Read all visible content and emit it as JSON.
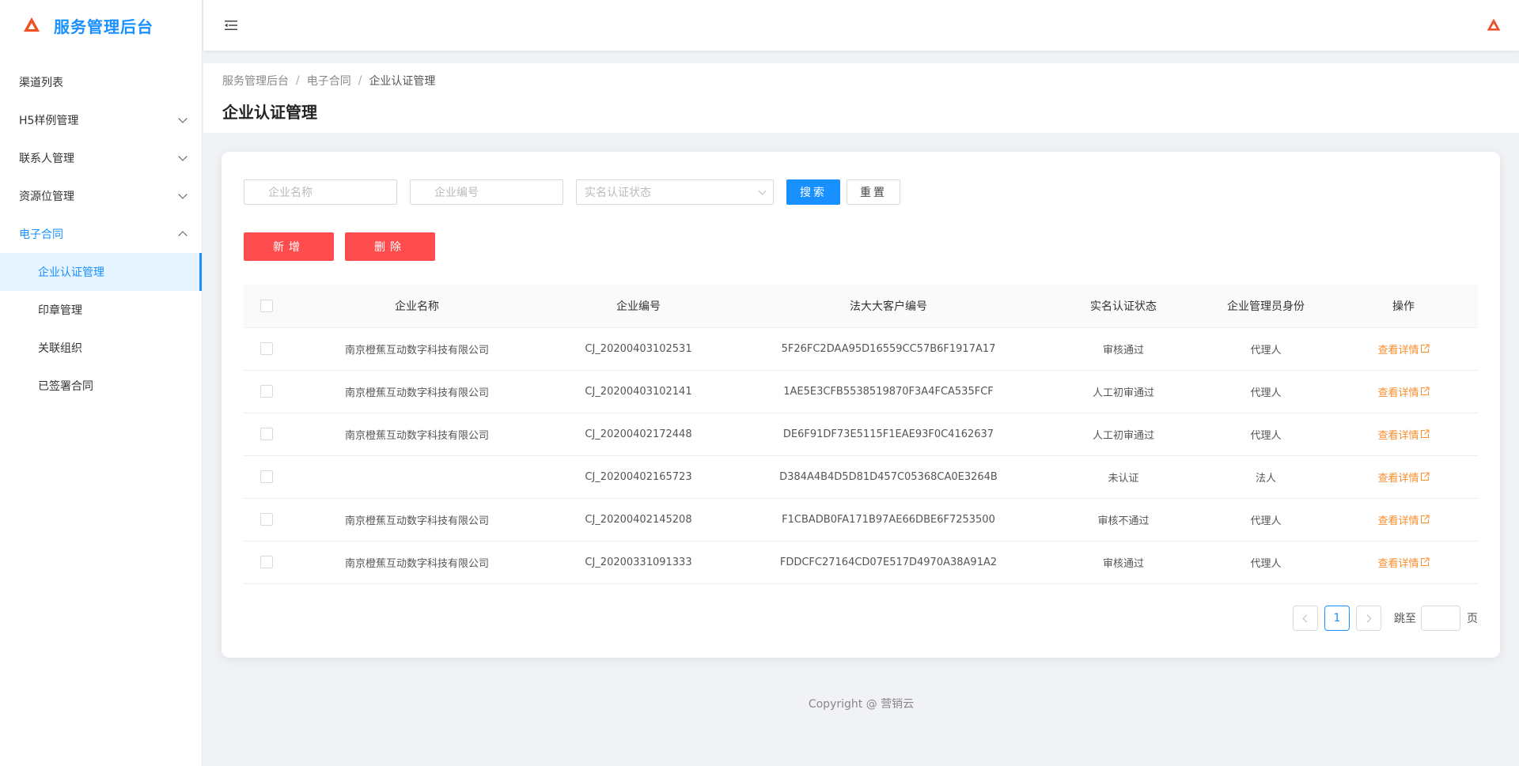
{
  "app": {
    "title": "服务管理后台"
  },
  "sidebar": {
    "items": [
      {
        "label": "渠道列表"
      },
      {
        "label": "H5样例管理"
      },
      {
        "label": "联系人管理"
      },
      {
        "label": "资源位管理"
      },
      {
        "label": "电子合同"
      }
    ],
    "sub_items": [
      {
        "label": "企业认证管理"
      },
      {
        "label": "印章管理"
      },
      {
        "label": "关联组织"
      },
      {
        "label": "已签署合同"
      }
    ]
  },
  "breadcrumb": {
    "root": "服务管理后台",
    "parent": "电子合同",
    "current": "企业认证管理"
  },
  "page": {
    "title": "企业认证管理"
  },
  "filters": {
    "name_placeholder": "企业名称",
    "code_placeholder": "企业编号",
    "status_placeholder": "实名认证状态",
    "search_label": "搜索",
    "reset_label": "重置"
  },
  "actions": {
    "add_label": "新增",
    "delete_label": "删除"
  },
  "table": {
    "headers": [
      "企业名称",
      "企业编号",
      "法大大客户编号",
      "实名认证状态",
      "企业管理员身份",
      "操作"
    ],
    "rows": [
      {
        "name": "南京橙蕉互动数字科技有限公司",
        "code": "CJ_20200403102531",
        "fdd": "5F26FC2DAA95D16559CC57B6F1917A17",
        "status": "审核通过",
        "role": "代理人",
        "action": "查看详情"
      },
      {
        "name": "南京橙蕉互动数字科技有限公司",
        "code": "CJ_20200403102141",
        "fdd": "1AE5E3CFB5538519870F3A4FCA535FCF",
        "status": "人工初审通过",
        "role": "代理人",
        "action": "查看详情"
      },
      {
        "name": "南京橙蕉互动数字科技有限公司",
        "code": "CJ_20200402172448",
        "fdd": "DE6F91DF73E5115F1EAE93F0C4162637",
        "status": "人工初审通过",
        "role": "代理人",
        "action": "查看详情"
      },
      {
        "name": "",
        "code": "CJ_20200402165723",
        "fdd": "D384A4B4D5D81D457C05368CA0E3264B",
        "status": "未认证",
        "role": "法人",
        "action": "查看详情"
      },
      {
        "name": "南京橙蕉互动数字科技有限公司",
        "code": "CJ_20200402145208",
        "fdd": "F1CBADB0FA171B97AE66DBE6F7253500",
        "status": "审核不通过",
        "role": "代理人",
        "action": "查看详情"
      },
      {
        "name": "南京橙蕉互动数字科技有限公司",
        "code": "CJ_20200331091333",
        "fdd": "FDDCFC27164CD07E517D4970A38A91A2",
        "status": "审核通过",
        "role": "代理人",
        "action": "查看详情"
      }
    ]
  },
  "pagination": {
    "current": "1",
    "jump_label": "跳至",
    "jump_suffix": "页"
  },
  "footer": {
    "text": "Copyright @ 营销云"
  },
  "colors": {
    "primary": "#1890ff",
    "danger": "#ff4d4f",
    "link": "#fa8c2c",
    "logo": "#f04e23"
  }
}
